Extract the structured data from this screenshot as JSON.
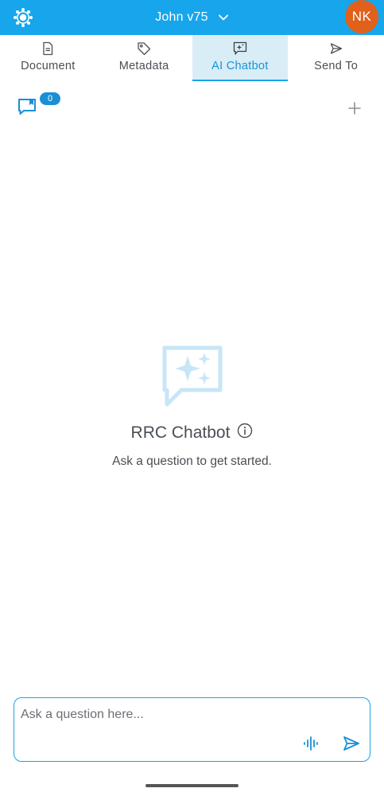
{
  "header": {
    "title": "John v75",
    "logo_icon": "logo-icon",
    "dropdown_icon": "chevron-down-icon",
    "avatar_initials": "NK",
    "avatar_color": "#e0601c",
    "bar_color": "#17a6ec"
  },
  "tabs": [
    {
      "label": "Document",
      "icon": "document-icon",
      "active": false
    },
    {
      "label": "Metadata",
      "icon": "tag-icon",
      "active": false
    },
    {
      "label": "AI Chatbot",
      "icon": "chat-sparkle-icon",
      "active": true
    },
    {
      "label": "Send To",
      "icon": "send-icon",
      "active": false
    }
  ],
  "subbar": {
    "history_icon": "chat-history-icon",
    "history_count": "0",
    "add_icon": "plus-icon"
  },
  "empty_state": {
    "icon": "chat-sparkle-icon",
    "heading": "RRC Chatbot",
    "info_icon": "info-icon",
    "subtitle": "Ask a question to get started."
  },
  "composer": {
    "placeholder": "Ask a question here...",
    "value": "",
    "mic_icon": "microphone-icon",
    "send_icon": "send-icon"
  },
  "accent_color": "#1aa3e8"
}
